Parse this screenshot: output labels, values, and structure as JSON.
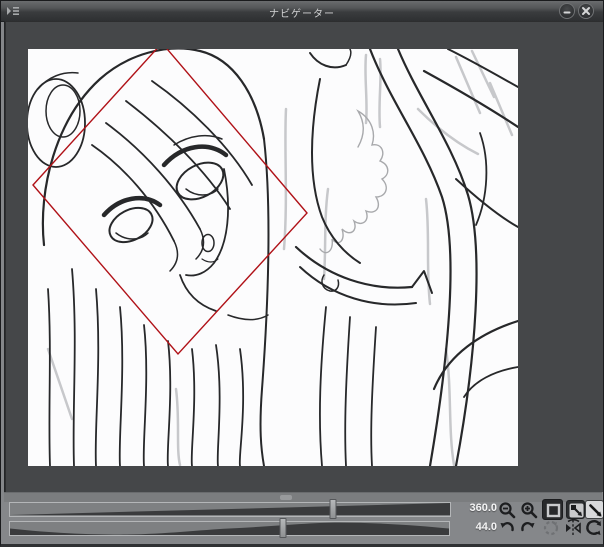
{
  "window": {
    "title": "ナビゲーター"
  },
  "titlebar": {
    "icons": [
      "panel-menu-icon",
      "minimize-icon",
      "close-icon"
    ]
  },
  "navigator": {
    "zoom": {
      "value": "360.0",
      "unit": "%",
      "slider_percent": 73.5,
      "icons": [
        "zoom-out-magnifier",
        "zoom-in-magnifier",
        "actual-size-square",
        "fit-to-screen-arrow",
        "fit-to-window-arrow"
      ]
    },
    "rotation": {
      "value": "44.0",
      "unit": "deg",
      "slider_percent": 62.1,
      "icons": [
        "rotate-ccw-arrow",
        "rotate-cw-arrow",
        "reset-rotation-dashed-circle",
        "flip-horizontal",
        "reset-view-arrow"
      ]
    },
    "buttons_state": {
      "fit_to_window_active": true,
      "reset_rotation_disabled": true
    },
    "view_rect": {
      "corners": "5,136 134,-6 279,164 150,305",
      "color": "#b01218"
    }
  },
  "colors": {
    "accent_red": "#b01218",
    "panel_bg": "#85878a",
    "canvas_margin": "#454749",
    "titlebar_dark": "#2e3032",
    "slider_fill": "#3a3b3d",
    "value_text": "#f4f4f5"
  }
}
